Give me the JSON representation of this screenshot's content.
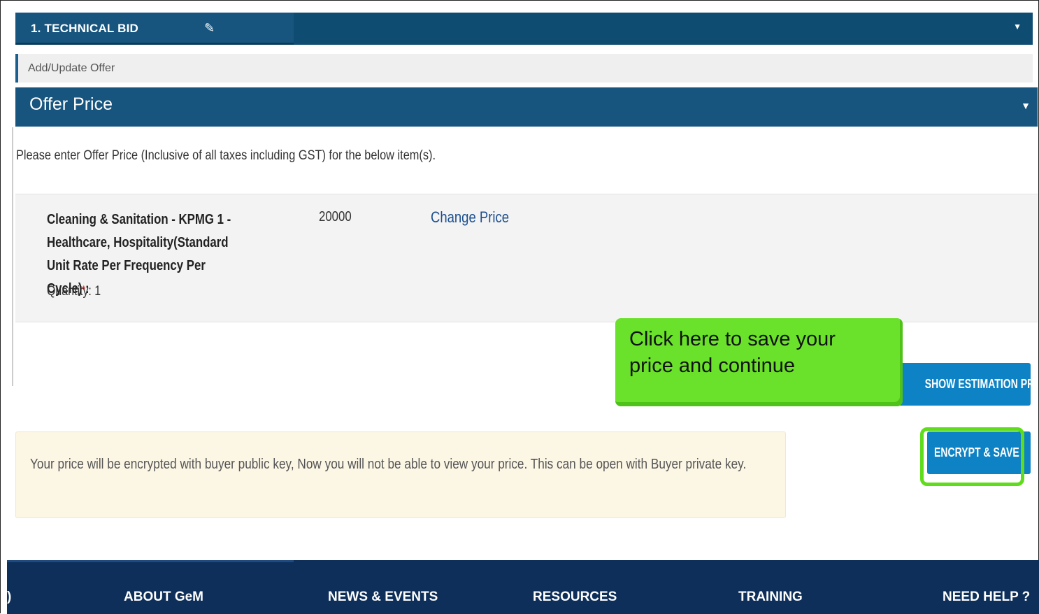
{
  "technical_bid": {
    "title": "1. TECHNICAL BID",
    "edit_icon": "edit-icon",
    "caret_icon": "caret-down-icon"
  },
  "add_update": {
    "label": "Add/Update Offer"
  },
  "offer_price": {
    "title": "Offer Price",
    "caret_icon": "caret-down-icon",
    "instruction": "Please enter Offer Price (Inclusive of all taxes including GST) for the below item(s)."
  },
  "item": {
    "name": "Cleaning & Sanitation - KPMG 1 - Healthcare, Hospitality(Standard Unit Rate Per Frequency Per Cycle)",
    "required_mark": "*",
    "suffix": ":",
    "quantity": "Quantity: 1",
    "price": "20000",
    "change_price_label": "Change Price"
  },
  "buttons": {
    "estimation_label": "SHOW ESTIMATION PRICE",
    "encrypt_label": "ENCRYPT & SAVE"
  },
  "callout": {
    "text": "Click here to save your price and continue"
  },
  "notice": {
    "text": "Your price will be encrypted with buyer public key, Now you will not be able to view your price. This can be open with Buyer private key."
  },
  "footer": {
    "partial_left": ")",
    "items": [
      "ABOUT GeM",
      "NEWS & EVENTS",
      "RESOURCES",
      "TRAINING",
      "NEED HELP ?"
    ]
  },
  "colors": {
    "header_blue": "#17557e",
    "button_blue": "#0d82c4",
    "callout_green": "#6ae12a",
    "highlight_green": "#5fdc1b",
    "footer_navy": "#0d2f5a",
    "notice_bg": "#fcf6e5"
  }
}
